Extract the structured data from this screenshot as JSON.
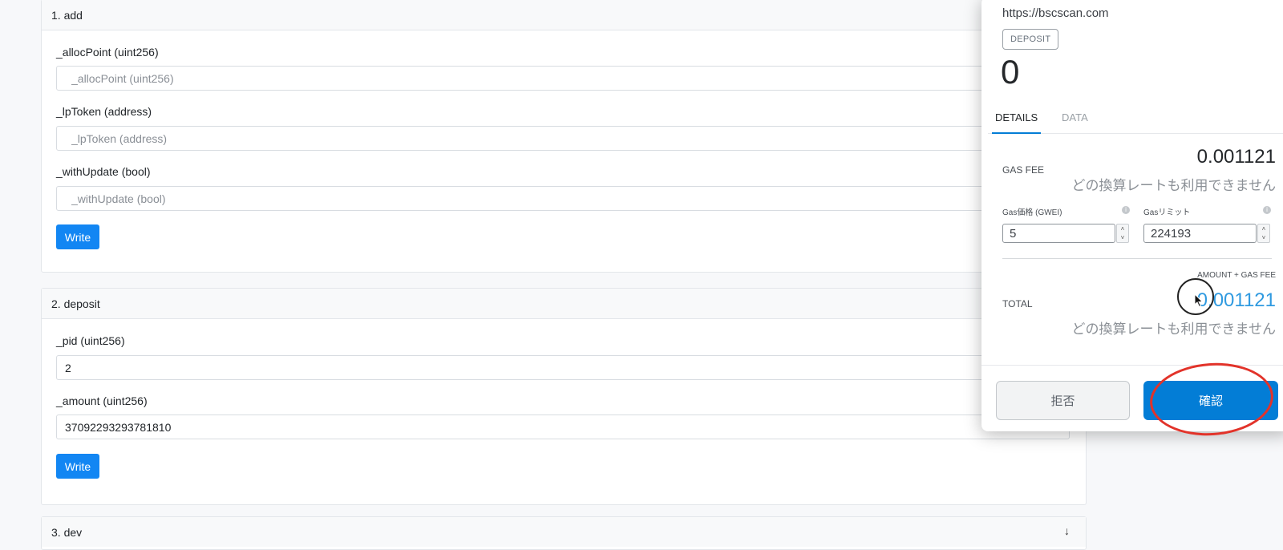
{
  "contract": {
    "functions": [
      {
        "header": "1. add",
        "fields": [
          {
            "label": "_allocPoint (uint256)",
            "placeholder": "_allocPoint (uint256)",
            "value": ""
          },
          {
            "label": "_lpToken (address)",
            "placeholder": "_lpToken (address)",
            "value": ""
          },
          {
            "label": "_withUpdate (bool)",
            "placeholder": "_withUpdate (bool)",
            "value": ""
          }
        ],
        "write_label": "Write"
      },
      {
        "header": "2. deposit",
        "fields": [
          {
            "label": "_pid (uint256)",
            "placeholder": "",
            "value": "2"
          },
          {
            "label": "_amount (uint256)",
            "placeholder": "",
            "value": "37092293293781810"
          }
        ],
        "write_label": "Write"
      },
      {
        "header": "3. dev",
        "chevron": "↓"
      }
    ]
  },
  "popup": {
    "origin": "https://bscscan.com",
    "method_badge": "DEPOSIT",
    "amount": "0",
    "tabs": {
      "details": "DETAILS",
      "data": "DATA"
    },
    "gas_fee_label": "GAS FEE",
    "gas_fee_value": "0.001121",
    "gas_fee_rate_note": "どの換算レートも利用できません",
    "gas_price_label": "Gas価格 (GWEI)",
    "gas_price_value": "5",
    "gas_limit_label": "Gasリミット",
    "gas_limit_value": "224193",
    "amount_gas_fee_label": "AMOUNT + GAS FEE",
    "total_label": "TOTAL",
    "total_value": "0.001121",
    "total_rate_note": "どの換算レートも利用できません",
    "reject_label": "拒否",
    "confirm_label": "確認"
  },
  "colors": {
    "write_button": "#1286f3",
    "confirm_button": "#037dd6",
    "total_value": "#2f9ae0",
    "annotation": "#e2332a"
  }
}
